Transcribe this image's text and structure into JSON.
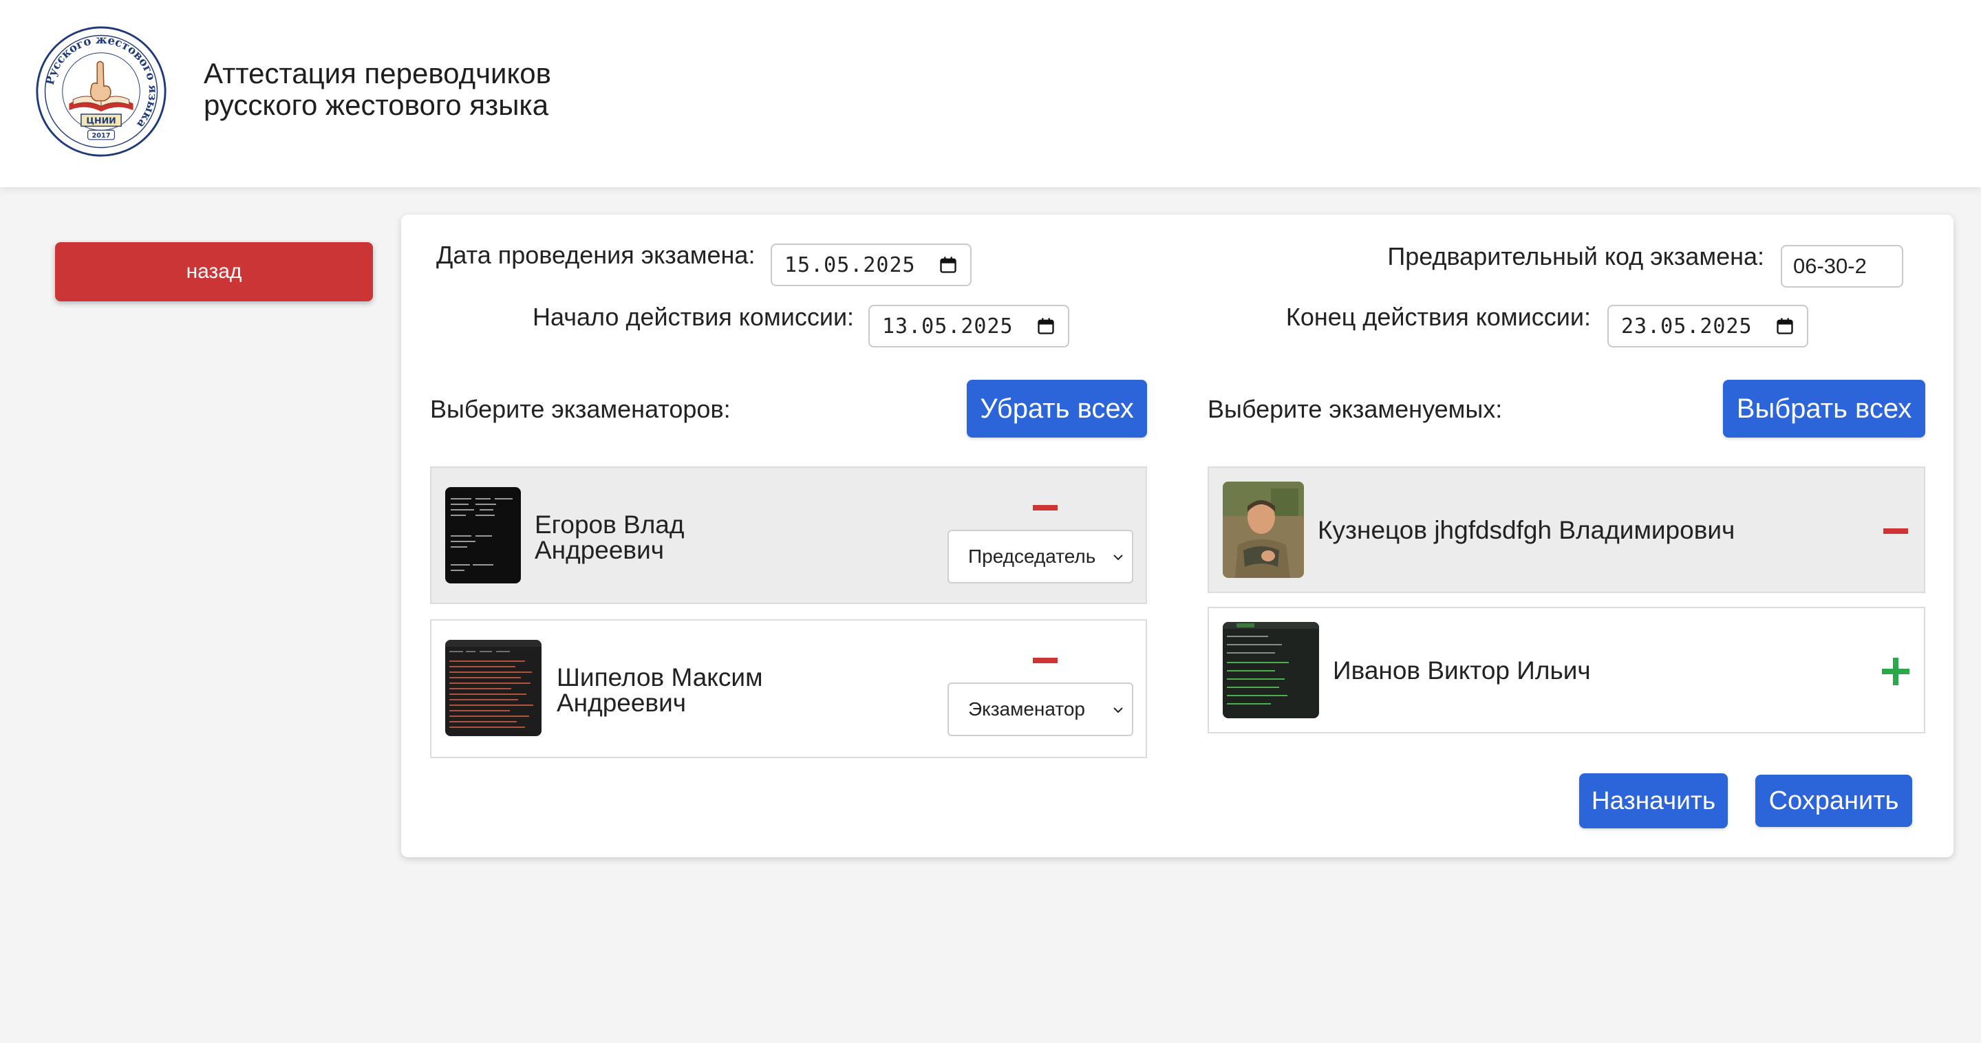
{
  "header": {
    "title_line1": "Аттестация переводчиков",
    "title_line2": "русского жестового языка",
    "logo": {
      "ring_text": "Русского жестового языка",
      "badge": "ЦНИИ",
      "year": "2017"
    }
  },
  "sidebar": {
    "back_label": "назад"
  },
  "form": {
    "exam_date_label": "Дата проведения экзамена:",
    "exam_date_value": "15.05.2025",
    "exam_code_label": "Предварительный код экзамена:",
    "exam_code_value": "06-30-2",
    "commission_start_label": "Начало действия комиссии:",
    "commission_start_value": "13.05.2025",
    "commission_end_label": "Конец действия комиссии:",
    "commission_end_value": "23.05.2025"
  },
  "examiners": {
    "heading": "Выберите экзаменаторов:",
    "action_label": "Убрать всех",
    "items": [
      {
        "line1": "Егоров Влад",
        "line2": "Андреевич",
        "role": "Председатель",
        "selected": true
      },
      {
        "line1": "Шипелов Максим",
        "line2": "Андреевич",
        "role": "Экзаменатор",
        "selected": false
      }
    ]
  },
  "examinees": {
    "heading": "Выберите экзаменуемых:",
    "action_label": "Выбрать всех",
    "items": [
      {
        "name": "Кузнецов jhgfdsdfgh Владимирович",
        "selected": true
      },
      {
        "name": "Иванов Виктор Ильич",
        "selected": false
      }
    ]
  },
  "actions": {
    "assign_label": "Назначить",
    "save_label": "Сохранить"
  },
  "colors": {
    "primary": "#2c65d9",
    "danger": "#cc3535",
    "success": "#2aa84a",
    "selected_row": "#ececec",
    "page_bg": "#f4f4f4"
  },
  "icons": [
    "logo-emblem",
    "calendar-icon",
    "minus-icon",
    "plus-icon",
    "chevron-down-icon"
  ]
}
